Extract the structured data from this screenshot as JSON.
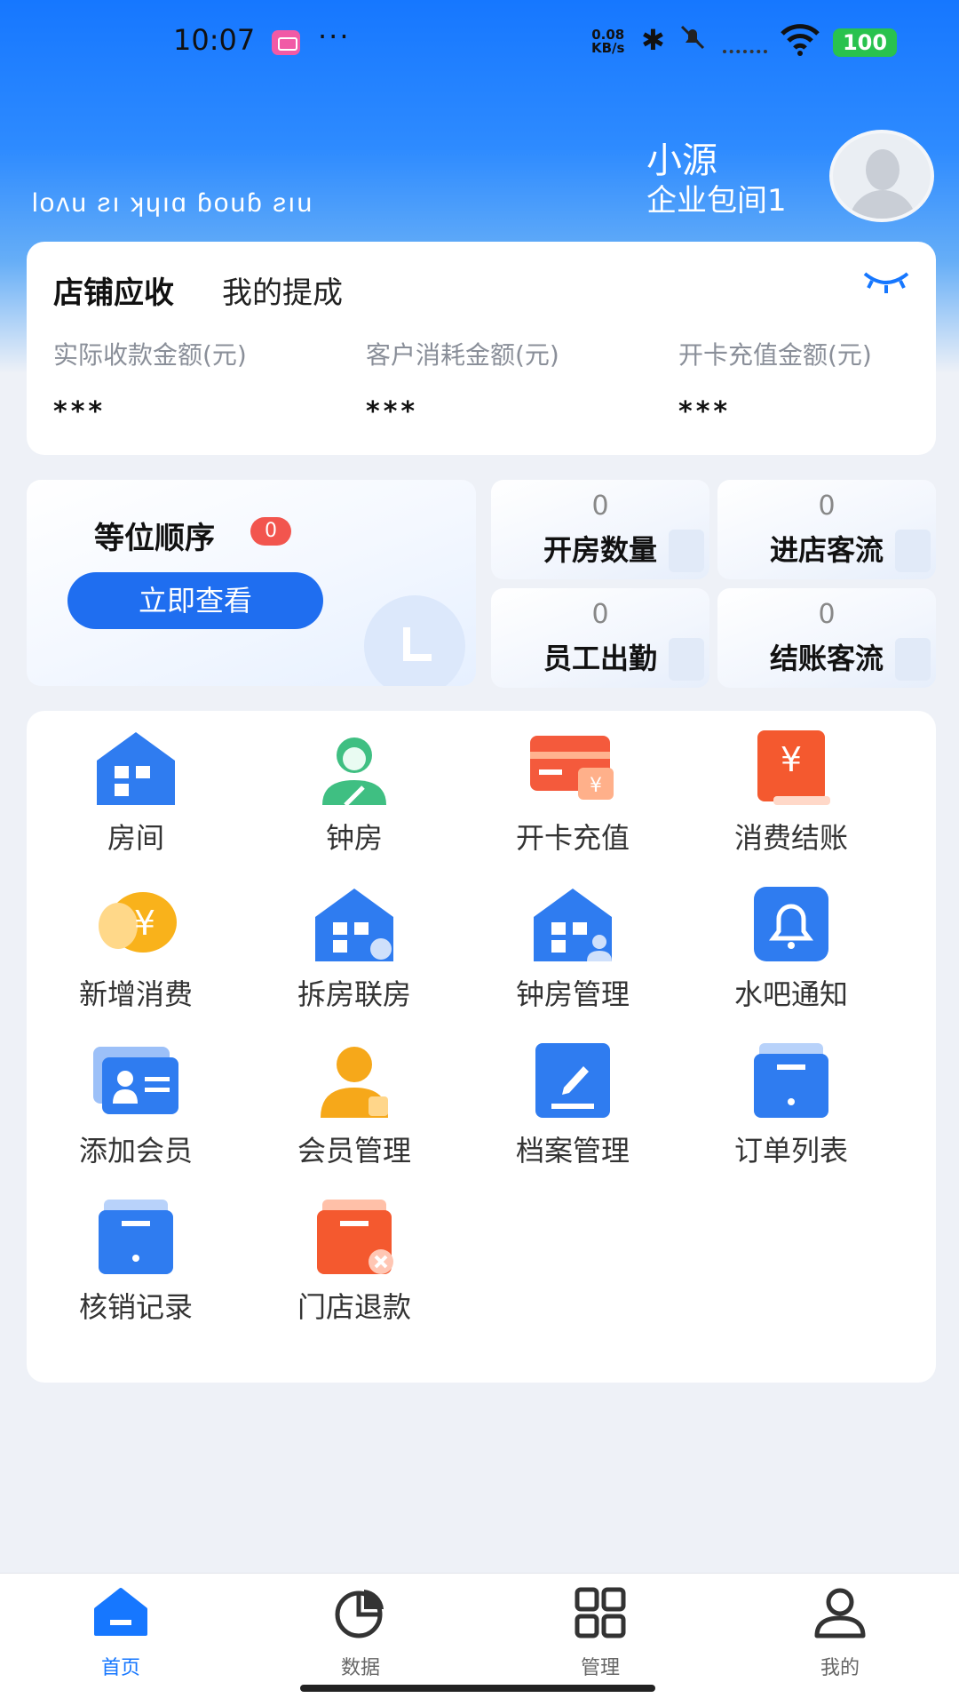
{
  "status_bar": {
    "time": "10:07",
    "dots": "···",
    "speed_value": "0.08",
    "speed_unit": "KB/s",
    "battery": "100"
  },
  "header": {
    "welcome_text": "Ɩᴏʌu ƨı ʞɥıɑ ɓᴏuɓ ƨıu",
    "user_name": "小源",
    "store_name": "企业包间1"
  },
  "revenue": {
    "tab_active": "店铺应收",
    "tab_other": "我的提成",
    "stats": [
      {
        "label": "实际收款金额(元)",
        "value": "***"
      },
      {
        "label": "客户消耗金额(元)",
        "value": "***"
      },
      {
        "label": "开卡充值金额(元)",
        "value": "***"
      }
    ]
  },
  "queue": {
    "title": "等位顺序",
    "badge": "0",
    "button_label": "立即查看"
  },
  "stats": [
    {
      "value": "0",
      "label": "开房数量"
    },
    {
      "value": "0",
      "label": "进店客流"
    },
    {
      "value": "0",
      "label": "员工出勤"
    },
    {
      "value": "0",
      "label": "结账客流"
    }
  ],
  "menu": [
    {
      "label": "房间",
      "icon": "room-icon"
    },
    {
      "label": "钟房",
      "icon": "clock-room-icon"
    },
    {
      "label": "开卡充值",
      "icon": "card-recharge-icon"
    },
    {
      "label": "消费结账",
      "icon": "checkout-icon"
    },
    {
      "label": "新增消费",
      "icon": "add-consumption-icon"
    },
    {
      "label": "拆房联房",
      "icon": "split-merge-room-icon"
    },
    {
      "label": "钟房管理",
      "icon": "clock-room-manage-icon"
    },
    {
      "label": "水吧通知",
      "icon": "bell-icon"
    },
    {
      "label": "添加会员",
      "icon": "add-member-icon"
    },
    {
      "label": "会员管理",
      "icon": "member-manage-icon"
    },
    {
      "label": "档案管理",
      "icon": "archive-edit-icon"
    },
    {
      "label": "订单列表",
      "icon": "order-list-icon"
    },
    {
      "label": "核销记录",
      "icon": "writeoff-record-icon"
    },
    {
      "label": "门店退款",
      "icon": "refund-icon"
    }
  ],
  "nav": [
    {
      "label": "首页",
      "icon": "home-icon"
    },
    {
      "label": "数据",
      "icon": "pie-chart-icon"
    },
    {
      "label": "管理",
      "icon": "grid-icon"
    },
    {
      "label": "我的",
      "icon": "user-icon"
    }
  ],
  "colors": {
    "primary": "#1677ff",
    "badge": "#f2554e",
    "button": "#1f6ef0"
  }
}
